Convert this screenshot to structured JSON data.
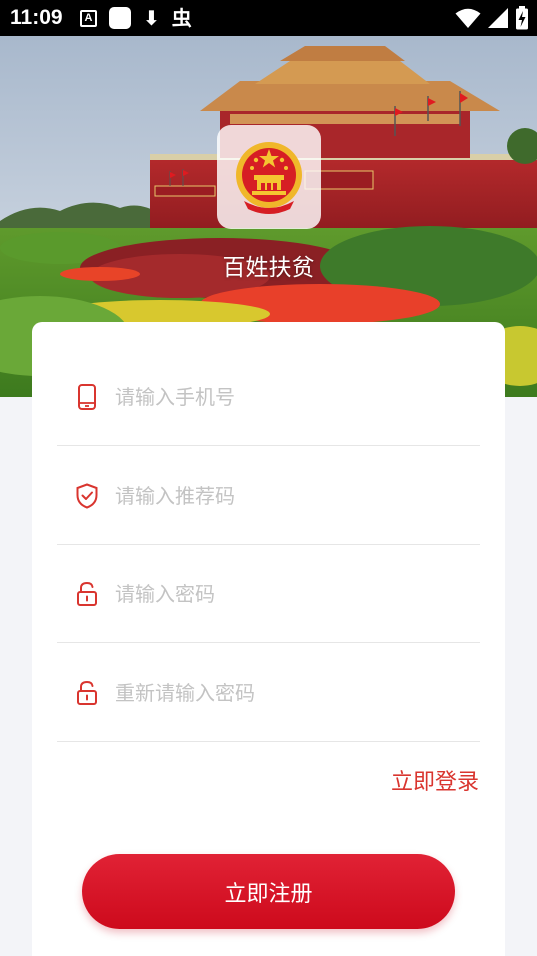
{
  "status_bar": {
    "time": "11:09",
    "left_icons": [
      "notification-a-icon",
      "app-square-icon",
      "download-icon",
      "bug-icon"
    ],
    "right_icons": [
      "wifi-icon",
      "cell-signal-icon",
      "battery-charging-icon"
    ],
    "glyphs": {
      "a": "A",
      "download": "⬇",
      "bug": "虫"
    }
  },
  "header": {
    "app_name": "百姓扶贫",
    "banner": "tiananmen-flowerbed-photo",
    "logo": "national-emblem-icon"
  },
  "form": {
    "fields": [
      {
        "icon": "phone-icon",
        "placeholder": "请输入手机号",
        "value": ""
      },
      {
        "icon": "shield-check-icon",
        "placeholder": "请输入推荐码",
        "value": ""
      },
      {
        "icon": "lock-icon",
        "placeholder": "请输入密码",
        "value": ""
      },
      {
        "icon": "lock-icon",
        "placeholder": "重新请输入密码",
        "value": ""
      }
    ],
    "login_link": "立即登录",
    "register_button": "立即注册"
  },
  "colors": {
    "accent": "#d9352f",
    "button": "#dc1a2c",
    "background": "#f3f4f8",
    "placeholder": "#c3c3c3"
  }
}
